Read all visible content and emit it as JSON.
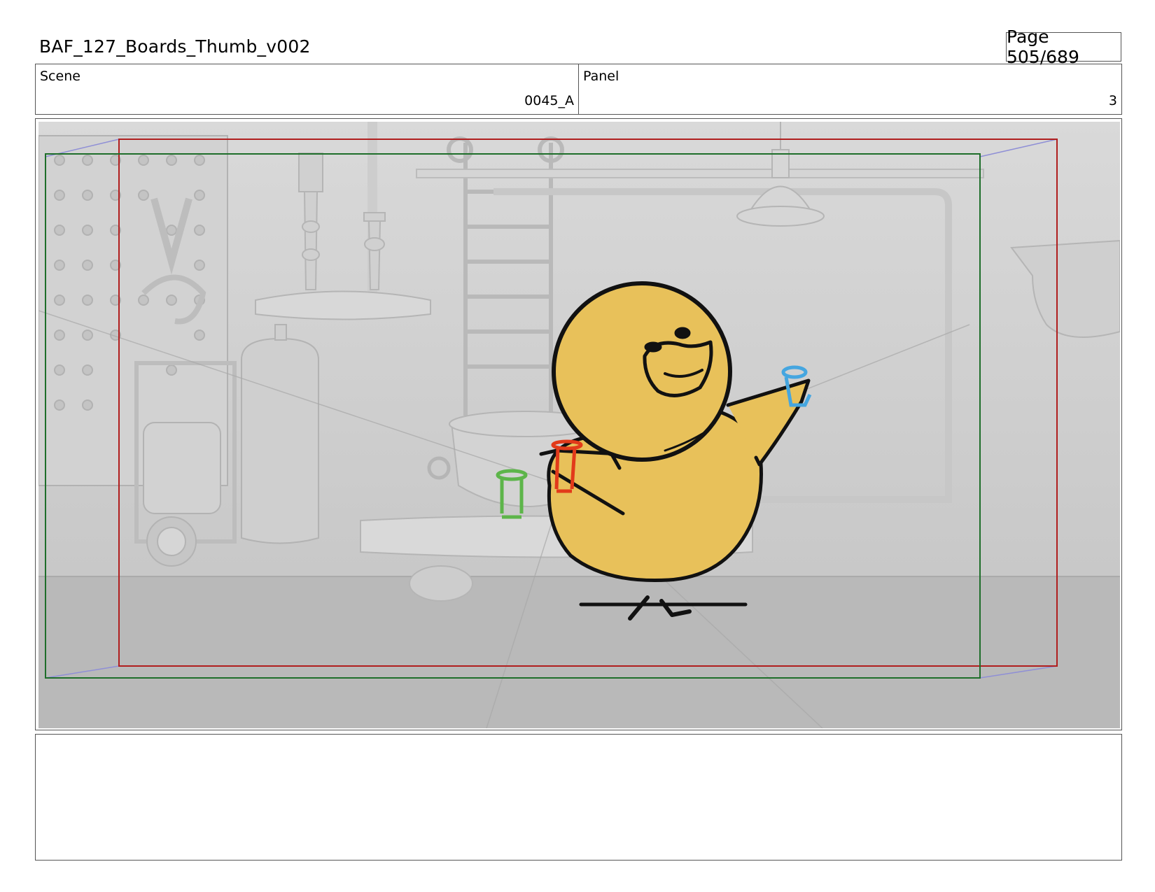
{
  "header": {
    "title": "BAF_127_Boards_Thumb_v002",
    "page": "Page 505/689"
  },
  "info": {
    "scene_label": "Scene",
    "scene_value": "0045_A",
    "panel_label": "Panel",
    "panel_value": "3"
  },
  "notes": {
    "text": ""
  },
  "colors": {
    "safe_frame_red": "#b01e1e",
    "safe_frame_green": "#1e6e2a",
    "character_fill": "#e8c15a",
    "prop_red": "#e23a1a",
    "prop_green": "#5db54a",
    "prop_blue": "#45a6e0"
  }
}
